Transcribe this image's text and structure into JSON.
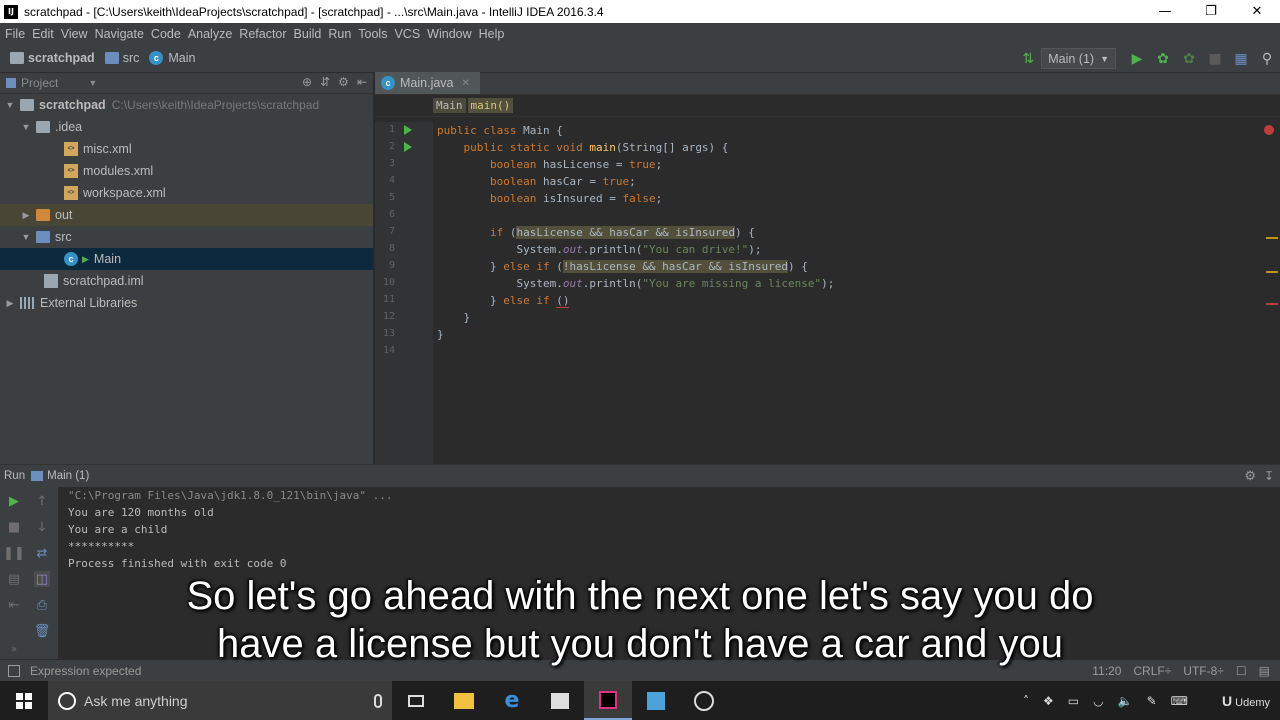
{
  "window": {
    "title": "scratchpad - [C:\\Users\\keith\\IdeaProjects\\scratchpad] - [scratchpad] - ...\\src\\Main.java - IntelliJ IDEA 2016.3.4",
    "app_icon": "IJ"
  },
  "menu": [
    "File",
    "Edit",
    "View",
    "Navigate",
    "Code",
    "Analyze",
    "Refactor",
    "Build",
    "Run",
    "Tools",
    "VCS",
    "Window",
    "Help"
  ],
  "navbar": {
    "crumbs": [
      "scratchpad",
      "src",
      "Main"
    ],
    "run_config": "Main (1)"
  },
  "project": {
    "header": "Project",
    "tree": [
      {
        "label": "scratchpad",
        "path": "C:\\Users\\keith\\IdeaProjects\\scratchpad"
      },
      {
        "label": ".idea"
      },
      {
        "label": "misc.xml"
      },
      {
        "label": "modules.xml"
      },
      {
        "label": "workspace.xml"
      },
      {
        "label": "out"
      },
      {
        "label": "src"
      },
      {
        "label": "Main"
      },
      {
        "label": "scratchpad.iml"
      },
      {
        "label": "External Libraries"
      }
    ]
  },
  "editor": {
    "tab": "Main.java",
    "breadcrumbs": [
      "Main",
      "main()"
    ],
    "line_numbers": [
      "1",
      "2",
      "3",
      "4",
      "5",
      "6",
      "7",
      "8",
      "9",
      "10",
      "11",
      "12",
      "13",
      "14"
    ]
  },
  "run": {
    "label": "Run",
    "config": "Main (1)",
    "console": [
      "\"C:\\Program Files\\Java\\jdk1.8.0_121\\bin\\java\" ...",
      "You are 120 months old",
      "You are a child",
      "**********",
      "",
      "Process finished with exit code 0"
    ]
  },
  "status": {
    "message": "Expression expected",
    "position": "11:20",
    "line_sep": "CRLF÷",
    "encoding": "UTF-8÷"
  },
  "subtitle": {
    "line1": "So let's go ahead with the next one let's say you do",
    "line2": "have a license but you don't have a car and you"
  },
  "taskbar": {
    "search_placeholder": "Ask me anything",
    "brand": "Udemy"
  }
}
